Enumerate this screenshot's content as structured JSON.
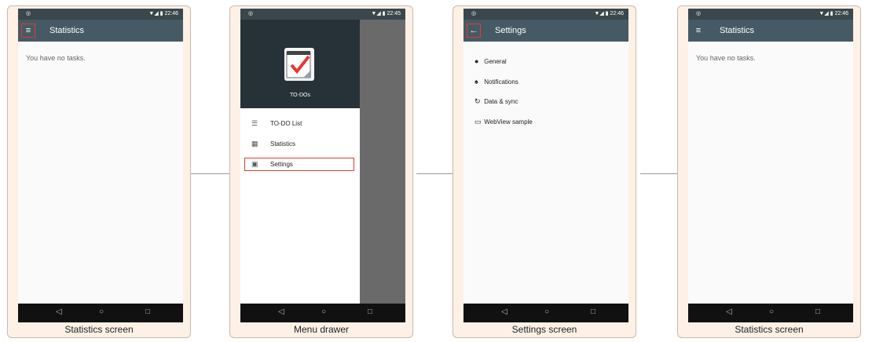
{
  "status_bar": {
    "left_icon": "notification-icon",
    "signal_text": "▼◢ ▮",
    "time_a": "22:46",
    "time_b": "22:45"
  },
  "screens": [
    {
      "caption": "Statistics screen",
      "title": "Statistics",
      "body_text": "You have no tasks."
    },
    {
      "caption": "Menu drawer",
      "header_label": "TO-DOs",
      "items": [
        {
          "icon": "list-icon",
          "label": "TO-DO List"
        },
        {
          "icon": "bar-chart-icon",
          "label": "Statistics"
        },
        {
          "icon": "settings-icon",
          "label": "Settings"
        }
      ]
    },
    {
      "caption": "Settings screen",
      "title": "Settings",
      "items": [
        {
          "icon": "info-icon",
          "label": "General"
        },
        {
          "icon": "bell-icon",
          "label": "Notifications"
        },
        {
          "icon": "sync-icon",
          "label": "Data & sync"
        },
        {
          "icon": "web-icon",
          "label": "WebView sample"
        }
      ]
    },
    {
      "caption": "Statistics screen",
      "title": "Statistics",
      "body_text": "You have no tasks."
    }
  ],
  "nav": {
    "back": "◁",
    "home": "○",
    "recent": "□"
  },
  "colors": {
    "appbar": "#455a64",
    "highlight": "#e53935",
    "card_bg": "#fdf1e6"
  }
}
